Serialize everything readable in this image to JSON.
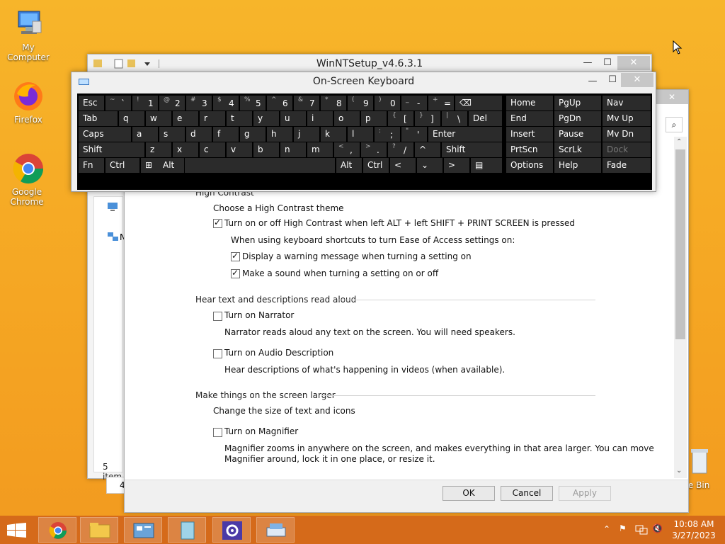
{
  "desktop": {
    "icons": [
      {
        "label": "My Computer"
      },
      {
        "label": "Firefox"
      },
      {
        "label": "Google Chrome"
      },
      {
        "label": "cle Bin"
      }
    ]
  },
  "winnt": {
    "title": "WinNTSetup_v4.6.3.1"
  },
  "explorer": {
    "status": "5 item",
    "nav_n": "N",
    "nav_4": "4"
  },
  "osk": {
    "title": "On-Screen Keyboard",
    "rows": {
      "r1": [
        {
          "label": "Esc"
        },
        {
          "sh": "~",
          "base": "`"
        },
        {
          "sh": "!",
          "base": "1"
        },
        {
          "sh": "@",
          "base": "2"
        },
        {
          "sh": "#",
          "base": "3"
        },
        {
          "sh": "$",
          "base": "4"
        },
        {
          "sh": "%",
          "base": "5"
        },
        {
          "sh": "^",
          "base": "6"
        },
        {
          "sh": "&",
          "base": "7"
        },
        {
          "sh": "*",
          "base": "8"
        },
        {
          "sh": "(",
          "base": "9"
        },
        {
          "sh": ")",
          "base": "0"
        },
        {
          "sh": "_",
          "base": "-"
        },
        {
          "sh": "+",
          "base": "="
        },
        {
          "label": "⌫"
        }
      ],
      "r2": [
        {
          "label": "Tab"
        },
        {
          "label": "q"
        },
        {
          "label": "w"
        },
        {
          "label": "e"
        },
        {
          "label": "r"
        },
        {
          "label": "t"
        },
        {
          "label": "y"
        },
        {
          "label": "u"
        },
        {
          "label": "i"
        },
        {
          "label": "o"
        },
        {
          "label": "p"
        },
        {
          "sh": "{",
          "base": "["
        },
        {
          "sh": "}",
          "base": "]"
        },
        {
          "sh": "|",
          "base": "\\"
        },
        {
          "label": "Del"
        }
      ],
      "r3": [
        {
          "label": "Caps"
        },
        {
          "label": "a"
        },
        {
          "label": "s"
        },
        {
          "label": "d"
        },
        {
          "label": "f"
        },
        {
          "label": "g"
        },
        {
          "label": "h"
        },
        {
          "label": "j"
        },
        {
          "label": "k"
        },
        {
          "label": "l"
        },
        {
          "sh": ":",
          "base": ";"
        },
        {
          "sh": "\"",
          "base": "'"
        },
        {
          "label": "Enter"
        }
      ],
      "r4": [
        {
          "label": "Shift"
        },
        {
          "label": "z"
        },
        {
          "label": "x"
        },
        {
          "label": "c"
        },
        {
          "label": "v"
        },
        {
          "label": "b"
        },
        {
          "label": "n"
        },
        {
          "label": "m"
        },
        {
          "sh": "<",
          "base": ","
        },
        {
          "sh": ">",
          "base": "."
        },
        {
          "sh": "?",
          "base": "/"
        },
        {
          "label": "^"
        },
        {
          "label": "Shift"
        }
      ],
      "r5": [
        {
          "label": "Fn"
        },
        {
          "label": "Ctrl"
        },
        {
          "label": "⊞"
        },
        {
          "label": "Alt"
        },
        {
          "label": ""
        },
        {
          "label": "Alt"
        },
        {
          "label": "Ctrl"
        },
        {
          "label": "<"
        },
        {
          "label": "⌄"
        },
        {
          "label": ">"
        },
        {
          "label": "▤"
        }
      ],
      "nav": [
        [
          "Home",
          "PgUp",
          "Nav"
        ],
        [
          "End",
          "PgDn",
          "Mv Up"
        ],
        [
          "Insert",
          "Pause",
          "Mv Dn"
        ],
        [
          "PrtScn",
          "ScrLk",
          "Dock"
        ],
        [
          "Options",
          "Help",
          "Fade"
        ]
      ]
    }
  },
  "ease": {
    "section_high_contrast": "High Contrast",
    "choose_theme_link": "Choose a High Contrast theme",
    "hc_toggle": {
      "label": "Turn on or off High Contrast when left ALT + left SHIFT + PRINT SCREEN is pressed",
      "checked": true
    },
    "shortcut_intro": "When using keyboard shortcuts to turn Ease of Access settings on:",
    "warn_msg": {
      "label": "Display a warning message when turning a setting on",
      "checked": true
    },
    "sound_msg": {
      "label": "Make a sound when turning a setting on or off",
      "checked": true
    },
    "section_hear": "Hear text and descriptions read aloud",
    "narrator": {
      "label": "Turn on Narrator",
      "checked": false,
      "desc": "Narrator reads aloud any text on the screen. You will need speakers."
    },
    "audio_desc": {
      "label": "Turn on Audio Description",
      "checked": false,
      "desc": "Hear descriptions of what's happening in videos (when available)."
    },
    "section_larger": "Make things on the screen larger",
    "change_size_link": "Change the size of text and icons",
    "magnifier": {
      "label": "Turn on Magnifier",
      "checked": false,
      "desc1": "Magnifier zooms in anywhere on the screen, and makes everything in that area larger. You can move",
      "desc2": "Magnifier around, lock it in one place, or resize it."
    },
    "buttons": {
      "ok": "OK",
      "cancel": "Cancel",
      "apply": "Apply"
    }
  },
  "taskbar": {
    "time": "10:08 AM",
    "date": "3/27/2023"
  }
}
